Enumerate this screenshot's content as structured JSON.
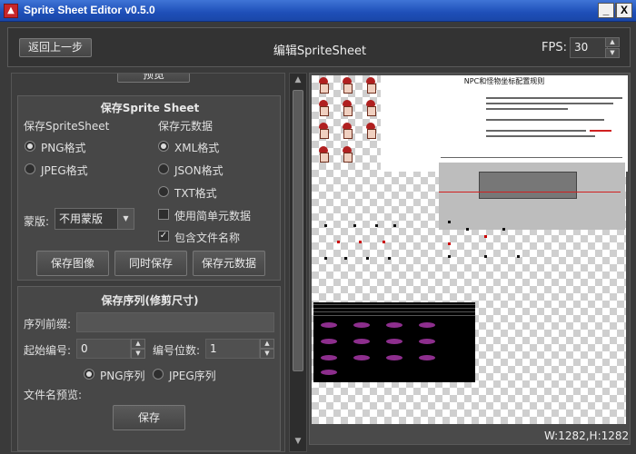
{
  "window": {
    "title": "Sprite Sheet Editor v0.5.0",
    "buttons": {
      "minimize": "_",
      "maximize": "□",
      "close": "X"
    }
  },
  "header": {
    "back_label": "返回上一步",
    "title": "编辑SpriteSheet",
    "fps_label": "FPS:",
    "fps_value": "30"
  },
  "left": {
    "top_cut_button": "预览",
    "save_sheet": {
      "title": "保存Sprite Sheet",
      "sheet_heading": "保存SpriteSheet",
      "meta_heading": "保存元数据",
      "png": "PNG格式",
      "jpeg": "JPEG格式",
      "xml": "XML格式",
      "json": "JSON格式",
      "txt": "TXT格式",
      "simple_meta": "使用简单元数据",
      "include_name": "包含文件名称",
      "mask_label": "蒙版:",
      "mask_value": "不用蒙版",
      "btn_save_image": "保存图像",
      "btn_save_both": "同时保存",
      "btn_save_meta": "保存元数据",
      "selected_sheet_format": "PNG",
      "selected_meta_format": "XML",
      "include_name_checked": true,
      "simple_meta_checked": false
    },
    "save_seq": {
      "title": "保存序列(修剪尺寸)",
      "prefix_label": "序列前缀:",
      "prefix_value": "",
      "start_label": "起始编号:",
      "start_value": "0",
      "digits_label": "编号位数:",
      "digits_value": "1",
      "png_seq": "PNG序列",
      "jpeg_seq": "JPEG序列",
      "selected_seq_format": "PNG",
      "preview_label": "文件名预览:",
      "save_button": "保存"
    }
  },
  "preview": {
    "doc_title": "NPC和怪物坐标配置规则",
    "size_text": "W:1282,H:1282"
  },
  "colors": {
    "accent": "#2a5cc4",
    "panel": "#474747",
    "background": "#3a3a3a"
  },
  "icons": {
    "app": "app-icon",
    "spin_up": "chevron-up-icon",
    "spin_down": "chevron-down-icon",
    "dropdown": "chevron-down-icon"
  }
}
